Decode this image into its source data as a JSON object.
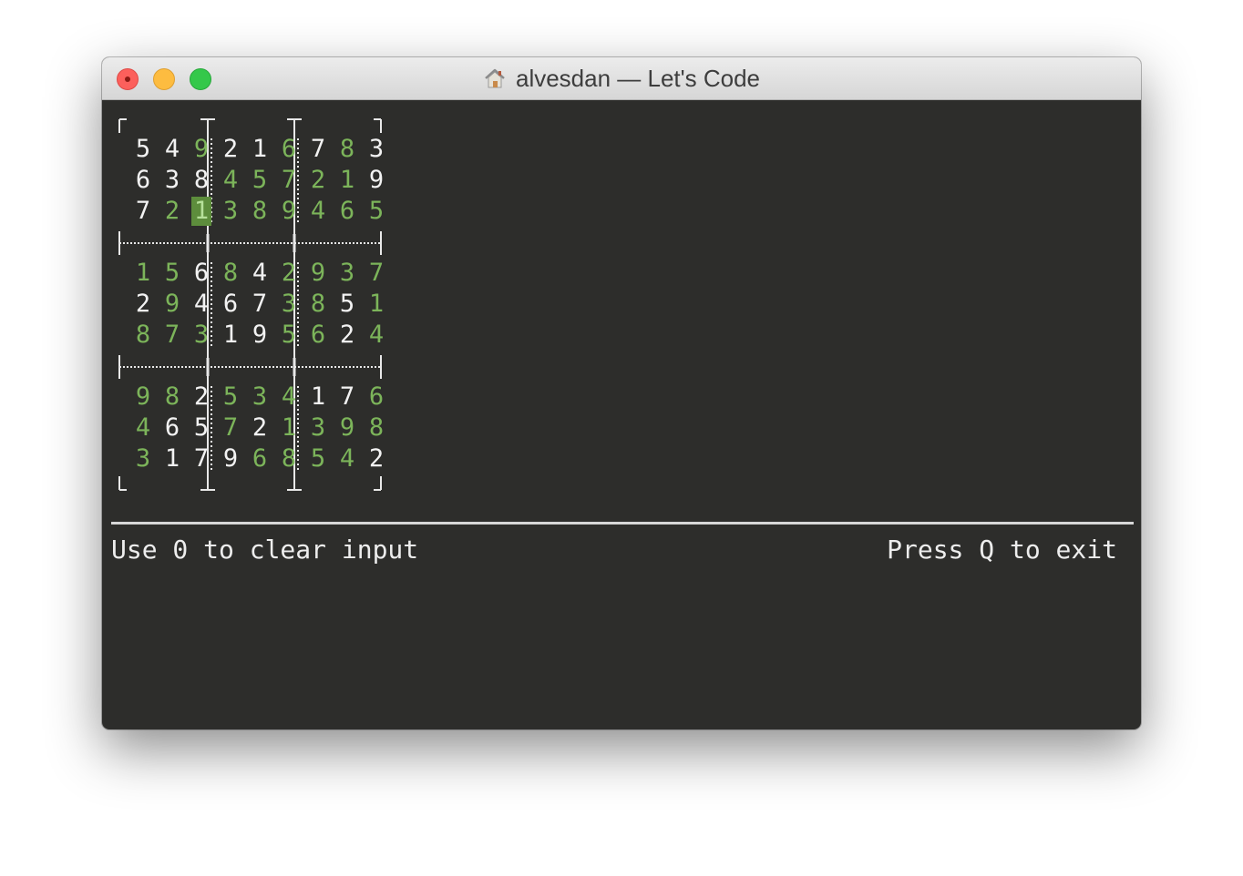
{
  "window": {
    "title": "alvesdan — Let's Code",
    "title_icon": "home-icon"
  },
  "sudoku": {
    "rows": [
      [
        "5",
        "4",
        "9",
        "2",
        "1",
        "6",
        "7",
        "8",
        "3"
      ],
      [
        "6",
        "3",
        "8",
        "4",
        "5",
        "7",
        "2",
        "1",
        "9"
      ],
      [
        "7",
        "2",
        "1",
        "3",
        "8",
        "9",
        "4",
        "6",
        "5"
      ],
      [
        "1",
        "5",
        "6",
        "8",
        "4",
        "2",
        "9",
        "3",
        "7"
      ],
      [
        "2",
        "9",
        "4",
        "6",
        "7",
        "3",
        "8",
        "5",
        "1"
      ],
      [
        "8",
        "7",
        "3",
        "1",
        "9",
        "5",
        "6",
        "2",
        "4"
      ],
      [
        "9",
        "8",
        "2",
        "5",
        "3",
        "4",
        "1",
        "7",
        "6"
      ],
      [
        "4",
        "6",
        "5",
        "7",
        "2",
        "1",
        "3",
        "9",
        "8"
      ],
      [
        "3",
        "1",
        "7",
        "9",
        "6",
        "8",
        "5",
        "4",
        "2"
      ]
    ],
    "given": [
      [
        1,
        1,
        0,
        1,
        1,
        0,
        1,
        0,
        1
      ],
      [
        1,
        1,
        1,
        0,
        0,
        0,
        0,
        0,
        1
      ],
      [
        1,
        0,
        0,
        0,
        0,
        0,
        0,
        0,
        0
      ],
      [
        0,
        0,
        1,
        0,
        1,
        0,
        0,
        0,
        0
      ],
      [
        1,
        0,
        1,
        1,
        1,
        0,
        0,
        1,
        0
      ],
      [
        0,
        0,
        0,
        1,
        1,
        0,
        0,
        1,
        0
      ],
      [
        0,
        0,
        1,
        0,
        0,
        0,
        1,
        1,
        0
      ],
      [
        0,
        1,
        1,
        0,
        1,
        0,
        0,
        0,
        0
      ],
      [
        0,
        1,
        1,
        1,
        0,
        0,
        0,
        0,
        1
      ]
    ],
    "cursor": {
      "row": 2,
      "col": 2
    }
  },
  "colors": {
    "terminal_background": "#2d2d2b",
    "given_digit": "#f2f2f2",
    "solved_digit": "#7cb45a",
    "cursor_background": "#5d8d3c",
    "grid_lines": "#e8e8e8"
  },
  "status": {
    "left": "Use 0 to clear input",
    "right": "Press Q to exit"
  }
}
